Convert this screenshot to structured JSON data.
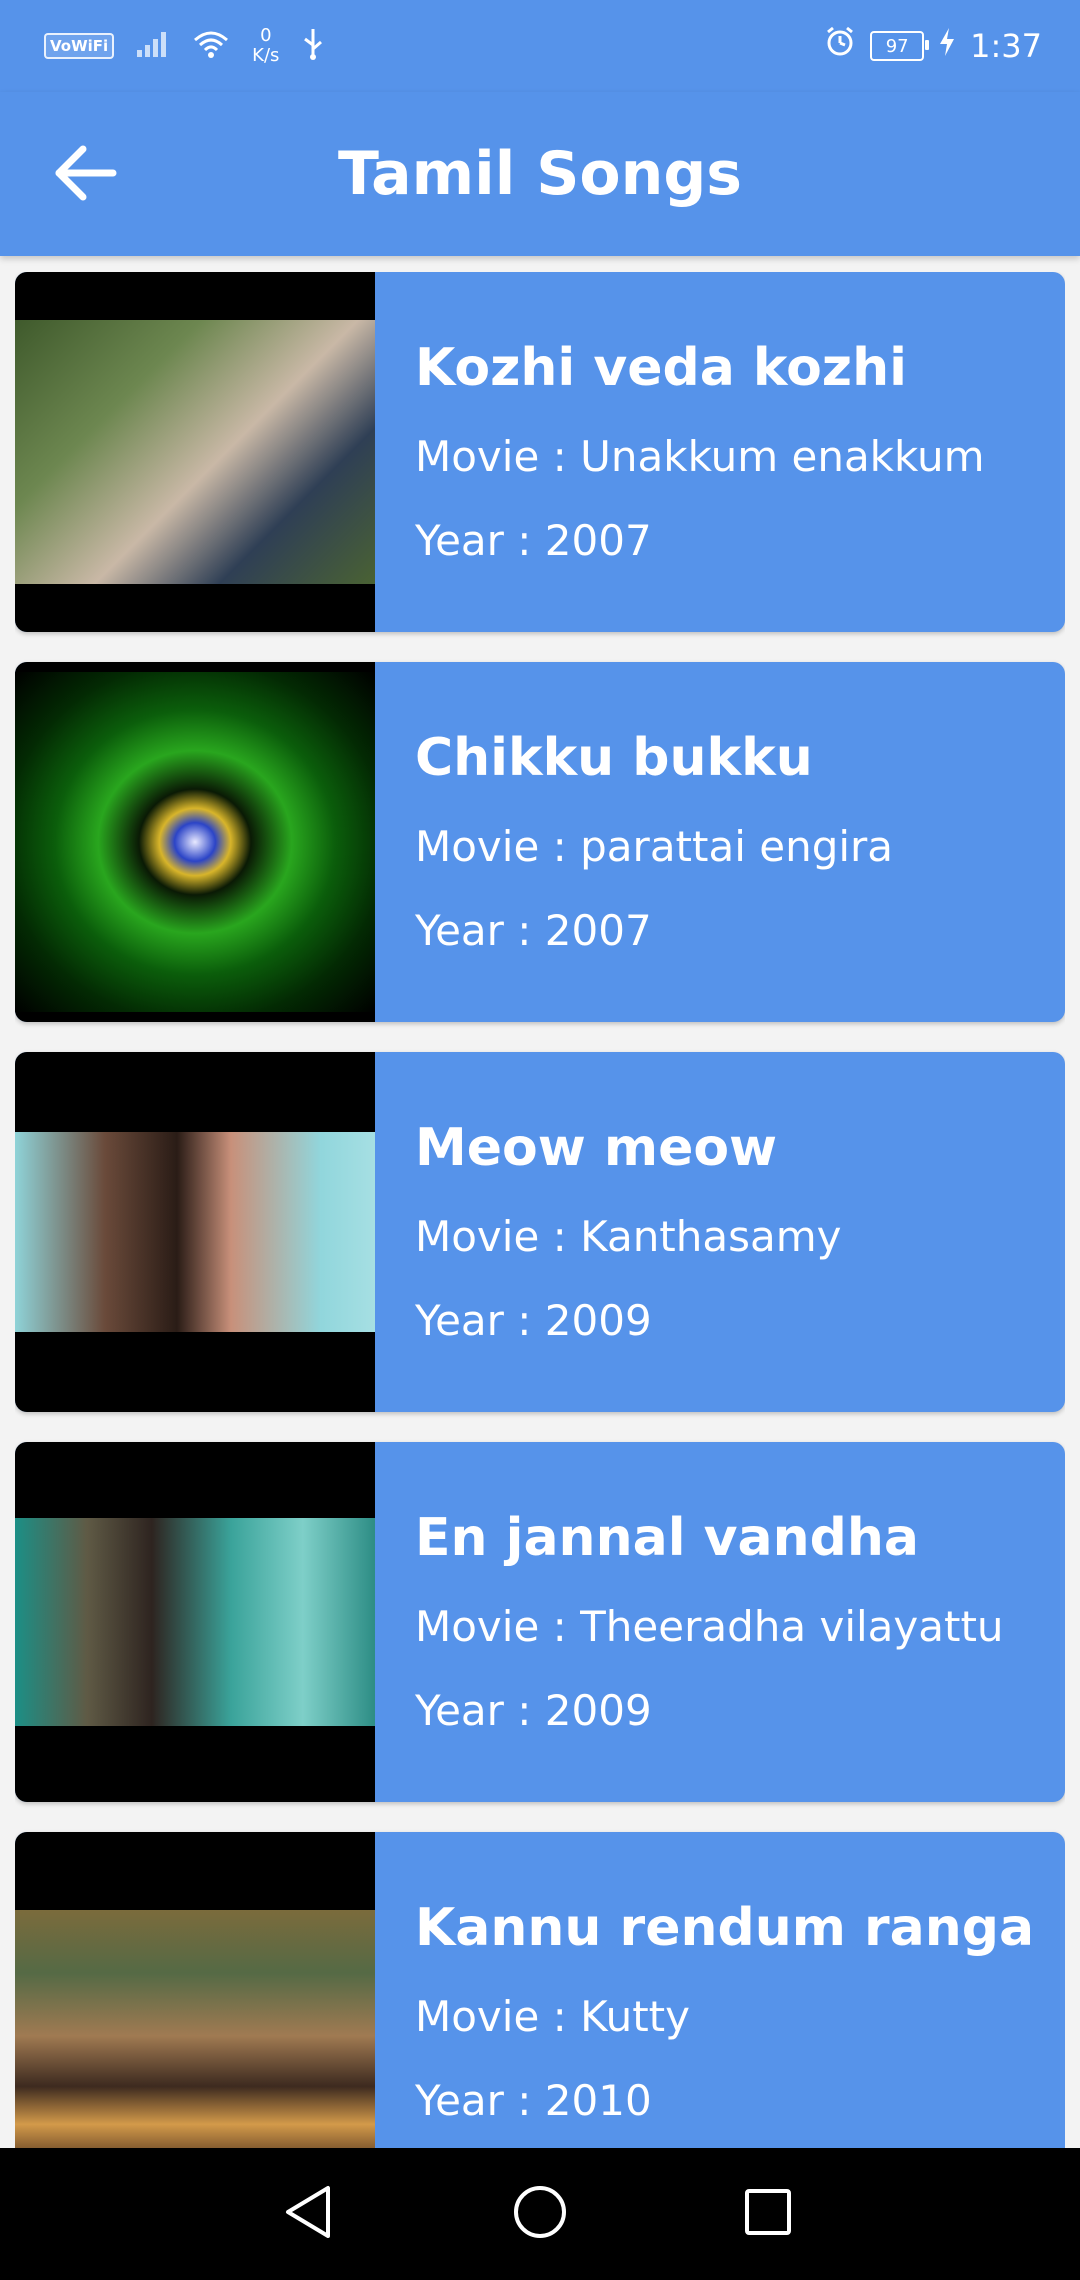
{
  "status_bar": {
    "vowifi": "VoWiFi",
    "speed_value": "0",
    "speed_unit": "K/s",
    "battery": "97",
    "time": "1:37"
  },
  "app_bar": {
    "title": "Tamil Songs",
    "back_icon": "arrow-left-icon"
  },
  "songs": [
    {
      "title": "Kozhi veda kozhi",
      "movie": "Movie : Unakkum enakkum",
      "year": "Year : 2007"
    },
    {
      "title": "Chikku bukku",
      "movie": "Movie : parattai engira",
      "year": "Year : 2007"
    },
    {
      "title": "Meow meow",
      "movie": "Movie : Kanthasamy",
      "year": "Year : 2009"
    },
    {
      "title": "En jannal vandha",
      "movie": "Movie : Theeradha vilayattu",
      "year": "Year : 2009"
    },
    {
      "title": "Kannu rendum ranga",
      "movie": "Movie : Kutty",
      "year": "Year : 2010"
    }
  ],
  "nav_bar": {
    "back": "nav-back-icon",
    "home": "nav-home-icon",
    "recents": "nav-recents-icon"
  },
  "colors": {
    "primary": "#5693ea",
    "background": "#f3f3f3",
    "nav": "#000000"
  }
}
